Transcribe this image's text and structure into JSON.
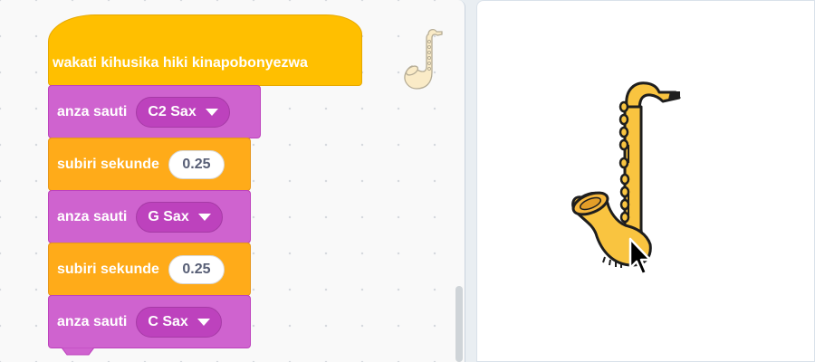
{
  "script": {
    "hat_label": "wakati kihusika hiki kinapobonyezwa",
    "blocks": [
      {
        "label": "anza sauti",
        "value": "C2 Sax"
      },
      {
        "label": "subiri sekunde",
        "value": "0.25"
      },
      {
        "label": "anza sauti",
        "value": "G Sax"
      },
      {
        "label": "subiri sekunde",
        "value": "0.25"
      },
      {
        "label": "anza sauti",
        "value": "C Sax"
      }
    ]
  },
  "icons": {
    "sprite_thumbnail": "saxophone-icon",
    "stage_sprite": "saxophone-icon",
    "cursor": "pointer-cursor-icon",
    "dropdown": "caret-down-icon"
  },
  "colors": {
    "events": "#ffbf00",
    "sound": "#cf63cf",
    "control": "#ffab19",
    "saxophone": "#f9c440"
  }
}
